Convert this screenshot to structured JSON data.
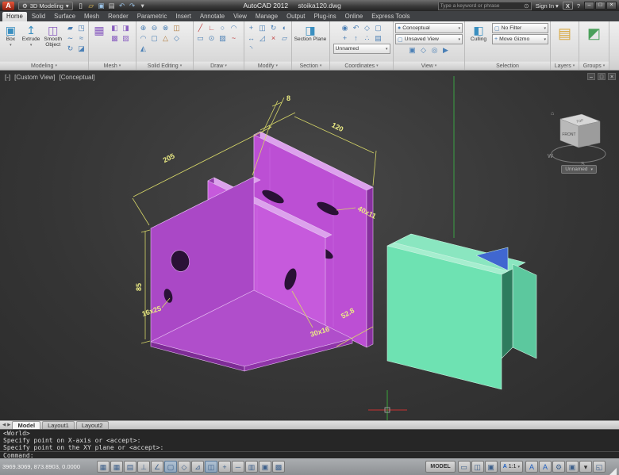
{
  "colors": {
    "part_purple": "#bc4fd4",
    "part_green": "#6ee2b2",
    "dim_yellow": "#ecec84",
    "axis_x_red": "#c83232",
    "axis_y_green": "#3aa043"
  },
  "glyphs": {
    "gear": "⚙",
    "home": "⌂",
    "min": "–",
    "restore": "□",
    "close": "×",
    "search": "⊙",
    "ann": "A",
    "box3d": "▣",
    "extrude": "↥",
    "smooth": "◫",
    "section_plane": "◨",
    "layers": "▤",
    "groups": "◩",
    "culling": "◧",
    "no_filter": "▢",
    "gizmo": "+",
    "visual_style": "●",
    "named_view": "▢",
    "mesh_big": "▦",
    "nav_prev": "◀",
    "nav_next": "▶",
    "vp_min": "–",
    "vp_restore": "□",
    "vp_close": "×",
    "help": "?"
  },
  "titlebar": {
    "logo_letter": "A",
    "workspace": "3D Modeling",
    "app_title": "AutoCAD 2012",
    "doc_title": "stoika120.dwg",
    "search_placeholder": "Type a keyword or phrase",
    "sign_in_label": "Sign In",
    "exchange_label": "X",
    "qat_icons": [
      {
        "n": "new-file",
        "g": "▯",
        "c": "#f0f0f0"
      },
      {
        "n": "open-file",
        "g": "▱",
        "c": "#e8c35a"
      },
      {
        "n": "save-file",
        "g": "▣",
        "c": "#9cc4e8"
      },
      {
        "n": "plot",
        "g": "▤",
        "c": "#cfcfcf"
      },
      {
        "n": "undo",
        "g": "↶",
        "c": "#9cc4e8"
      },
      {
        "n": "redo",
        "g": "↷",
        "c": "#9cc4e8"
      },
      {
        "n": "qat-menu",
        "g": "▾",
        "c": "#cccccc"
      }
    ]
  },
  "ribbon_tabs": {
    "items": [
      "Home",
      "Solid",
      "Surface",
      "Mesh",
      "Render",
      "Parametric",
      "Insert",
      "Annotate",
      "View",
      "Manage",
      "Output",
      "Plug-ins",
      "Online",
      "Express Tools"
    ],
    "active": "Home"
  },
  "panels": {
    "modeling": {
      "label": "Modeling",
      "box_label": "Box",
      "extrude_label": "Extrude",
      "smooth_label": "Smooth Object",
      "grid": [
        {
          "n": "polysolid",
          "g": "▰",
          "c": "#4a7fb5"
        },
        {
          "n": "presspull",
          "g": "◳",
          "c": "#4a7fb5"
        },
        {
          "n": "sweep",
          "g": "∼",
          "c": "#4a7fb5"
        },
        {
          "n": "loft",
          "g": "≈",
          "c": "#4a7fb5"
        },
        {
          "n": "revolve",
          "g": "↻",
          "c": "#4a7fb5"
        },
        {
          "n": "slice",
          "g": "◪",
          "c": "#4a7fb5"
        }
      ]
    },
    "mesh": {
      "label": "Mesh",
      "grid": [
        {
          "n": "smooth-more",
          "g": "◧",
          "c": "#8a5fc0"
        },
        {
          "n": "smooth-less",
          "g": "◨",
          "c": "#8a5fc0"
        },
        {
          "n": "refine-mesh",
          "g": "▩",
          "c": "#8a5fc0"
        },
        {
          "n": "add-crease",
          "g": "▨",
          "c": "#8a5fc0"
        }
      ]
    },
    "solid_editing": {
      "label": "Solid Editing",
      "grid": [
        {
          "n": "union",
          "g": "⊕",
          "c": "#4a7fb5"
        },
        {
          "n": "subtract",
          "g": "⊖",
          "c": "#4a7fb5"
        },
        {
          "n": "intersect",
          "g": "⊗",
          "c": "#4a7fb5"
        },
        {
          "n": "slice-solid",
          "g": "◫",
          "c": "#b07a3a"
        },
        {
          "n": "fillet-edge",
          "g": "◠",
          "c": "#4a7fb5"
        },
        {
          "n": "shell",
          "g": "▢",
          "c": "#4a7fb5"
        },
        {
          "n": "taper-face",
          "g": "△",
          "c": "#b07a3a"
        },
        {
          "n": "offset-edge",
          "g": "◇",
          "c": "#4a7fb5"
        },
        {
          "n": "separate",
          "g": "◭",
          "c": "#4a7fb5"
        }
      ]
    },
    "draw": {
      "label": "Draw",
      "grid": [
        {
          "n": "line",
          "g": "╱",
          "c": "#c04040"
        },
        {
          "n": "polyline",
          "g": "∟",
          "c": "#c04040"
        },
        {
          "n": "circle",
          "g": "○",
          "c": "#4a7fb5"
        },
        {
          "n": "arc",
          "g": "◠",
          "c": "#4a7fb5"
        },
        {
          "n": "rectangle",
          "g": "▭",
          "c": "#4a7fb5"
        },
        {
          "n": "ellipse",
          "g": "⊙",
          "c": "#4a7fb5"
        },
        {
          "n": "hatch",
          "g": "▨",
          "c": "#4a7fb5"
        },
        {
          "n": "spline",
          "g": "~",
          "c": "#c04040"
        }
      ]
    },
    "modify": {
      "label": "Modify",
      "grid": [
        {
          "n": "move",
          "g": "+",
          "c": "#4a7fb5"
        },
        {
          "n": "copy",
          "g": "◫",
          "c": "#4a7fb5"
        },
        {
          "n": "rotate",
          "g": "↻",
          "c": "#4a7fb5"
        },
        {
          "n": "mirror",
          "g": "◐",
          "c": "#4a7fb5"
        },
        {
          "n": "stretch",
          "g": "↔",
          "c": "#4a7fb5"
        },
        {
          "n": "scale",
          "g": "◿",
          "c": "#4a7fb5"
        },
        {
          "n": "trim",
          "g": "×",
          "c": "#c04040"
        },
        {
          "n": "erase",
          "g": "▱",
          "c": "#4a7fb5"
        },
        {
          "n": "fillet",
          "g": "◝",
          "c": "#4a7fb5"
        }
      ]
    },
    "section": {
      "label": "Section",
      "plane_label": "Section Plane"
    },
    "coordinates": {
      "label": "Coordinates",
      "ucs_value": "Unnamed",
      "row1": [
        {
          "n": "ucs-world",
          "g": "◉",
          "c": "#4a7fb5"
        },
        {
          "n": "ucs-previous",
          "g": "↶",
          "c": "#4a7fb5"
        },
        {
          "n": "ucs-face",
          "g": "◇",
          "c": "#4a7fb5"
        },
        {
          "n": "ucs-object",
          "g": "▢",
          "c": "#4a7fb5"
        }
      ],
      "row2": [
        {
          "n": "ucs-origin",
          "g": "+",
          "c": "#4a7fb5"
        },
        {
          "n": "ucs-z-axis",
          "g": "↑",
          "c": "#4a7fb5"
        },
        {
          "n": "ucs-3point",
          "g": "∴",
          "c": "#4a7fb5"
        },
        {
          "n": "ucs-named",
          "g": "▤",
          "c": "#4a7fb5"
        }
      ]
    },
    "view": {
      "label": "View",
      "visual_style": "Conceptual",
      "named_view": "Unsaved View",
      "row": [
        {
          "n": "view-camera",
          "g": "▣",
          "c": "#4a7fb5"
        },
        {
          "n": "view-perspective",
          "g": "◇",
          "c": "#4a7fb5"
        },
        {
          "n": "view-steering-wheel",
          "g": "◎",
          "c": "#4a7fb5"
        },
        {
          "n": "view-motion",
          "g": "▶",
          "c": "#4a7fb5"
        }
      ]
    },
    "selection": {
      "label": "Selection",
      "culling_label": "Culling",
      "filter_value": "No Filter",
      "gizmo_value": "Move Gizmo"
    },
    "layers": {
      "label": "Layers"
    },
    "groups": {
      "label": "Groups"
    }
  },
  "viewport": {
    "controls_label": "[-]",
    "view_label": "[Custom View]",
    "style_label": "[Conceptual]",
    "viewcube": {
      "front": "FRONT",
      "top": "TOP",
      "west": "W",
      "south": "S",
      "ucs": "Unnamed"
    },
    "dimensions": {
      "d8": "8",
      "d120": "120",
      "d205": "205",
      "d40x11": "40x11",
      "d85": "85",
      "d16x25": "16x25",
      "d30x16": "30x16",
      "d52_8": "52.8"
    }
  },
  "layout_tabs": {
    "model": "Model",
    "layout1": "Layout1",
    "layout2": "Layout2"
  },
  "command": {
    "lines": [
      "<World>",
      "Specify point on X-axis or <accept>:",
      "Specify point on the XY plane or <accept>:"
    ],
    "prompt": "Command:"
  },
  "statusbar": {
    "coords": "3969.3069, 873.8903, 0.0000",
    "toggles": [
      {
        "n": "infer-constraints",
        "g": "▦",
        "c": "#3c5f8a"
      },
      {
        "n": "snap-mode",
        "g": "▦",
        "c": "#3c5f8a"
      },
      {
        "n": "grid-display",
        "g": "▤",
        "c": "#3c5f8a"
      },
      {
        "n": "ortho-mode",
        "g": "⊥",
        "c": "#3c5f8a"
      },
      {
        "n": "polar-tracking",
        "g": "∠",
        "c": "#3c5f8a"
      },
      {
        "n": "object-snap",
        "g": "▢",
        "c": "#3c5f8a",
        "cls": "on"
      },
      {
        "n": "3d-object-snap",
        "g": "◇",
        "c": "#3c5f8a"
      },
      {
        "n": "object-snap-tracking",
        "g": "⊿",
        "c": "#3c5f8a"
      },
      {
        "n": "dynamic-ucs",
        "g": "◫",
        "c": "#3c5f8a",
        "cls": "on"
      },
      {
        "n": "dynamic-input",
        "g": "+",
        "c": "#3c5f8a"
      },
      {
        "n": "lineweight",
        "g": "─",
        "c": "#3c5f8a"
      },
      {
        "n": "transparency",
        "g": "▥",
        "c": "#3c5f8a"
      },
      {
        "n": "quick-properties",
        "g": "▣",
        "c": "#3c5f8a"
      },
      {
        "n": "selection-cycling",
        "g": "▩",
        "c": "#3c5f8a"
      }
    ],
    "model_label": "MODEL",
    "right_icons": [
      {
        "n": "layout-switch",
        "g": "▭",
        "c": "#3c5f8a"
      },
      {
        "n": "quick-view-layouts",
        "g": "◫",
        "c": "#3c5f8a"
      },
      {
        "n": "quick-view-drawings",
        "g": "▣",
        "c": "#3c5f8a"
      }
    ],
    "ann_scale": "1:1",
    "tray_icons": [
      {
        "n": "annotation-visibility",
        "g": "A",
        "c": "#2060c0"
      },
      {
        "n": "annotation-autoscale",
        "g": "A",
        "c": "#2060c0"
      },
      {
        "n": "workspace-switching",
        "g": "⚙",
        "c": "#3c5f8a"
      },
      {
        "n": "toolbar-lock",
        "g": "▣",
        "c": "#3c5f8a"
      },
      {
        "n": "status-menu",
        "g": "▾",
        "c": "#333333"
      },
      {
        "n": "clean-screen",
        "g": "◱",
        "c": "#3c5f8a"
      }
    ]
  }
}
